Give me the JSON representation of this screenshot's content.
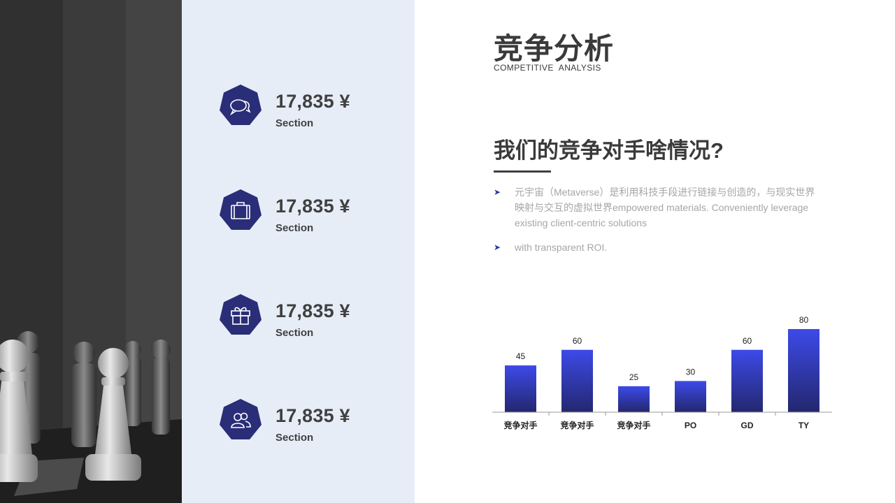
{
  "slide": {
    "title": "竞争分析",
    "subtitle": "COMPETITIVE  ANALYSIS",
    "heading": "我们的竞争对手啥情况?"
  },
  "stats": [
    {
      "value": "17,835 ¥",
      "label": "Section",
      "icon": "chat-bubbles-icon"
    },
    {
      "value": "17,835 ¥",
      "label": "Section",
      "icon": "briefcase-icon"
    },
    {
      "value": "17,835 ¥",
      "label": "Section",
      "icon": "gift-icon"
    },
    {
      "value": "17,835 ¥",
      "label": "Section",
      "icon": "users-icon"
    }
  ],
  "bullets": [
    {
      "arrow": "➤",
      "text": "元宇宙（Metaverse）是利用科技手段进行链接与创造的，与现实世界映射与交互的虚拟世界empowered materials. Conveniently leverage existing client-centric solutions"
    },
    {
      "arrow": "➤",
      "text": "with  transparent ROI."
    }
  ],
  "colors": {
    "accent": "#2a2d78",
    "bar_top": "#3d4ae8",
    "bar_bottom": "#23276e",
    "panel": "#e6edf7"
  },
  "chart_data": {
    "type": "bar",
    "categories": [
      "竞争对手",
      "竞争对手",
      "竞争对手",
      "PO",
      "GD",
      "TY"
    ],
    "values": [
      45,
      60,
      25,
      30,
      60,
      80
    ],
    "title": "",
    "xlabel": "",
    "ylabel": "",
    "ylim": [
      0,
      80
    ],
    "grid": false,
    "data_labels": true
  }
}
